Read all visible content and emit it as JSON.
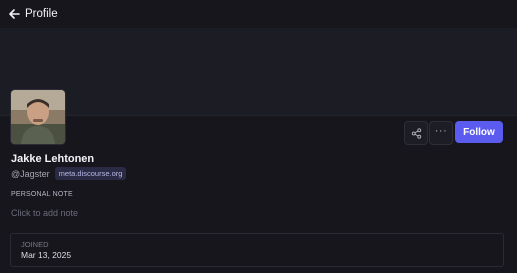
{
  "topbar": {
    "title": "Profile"
  },
  "profile": {
    "name": "Jakke Lehtonen",
    "handle": "@Jagster",
    "domain": "meta.discourse.org",
    "note_label": "PERSONAL NOTE",
    "note_placeholder": "Click to add note",
    "joined_label": "JOINED",
    "joined_date": "Mar 13, 2025"
  },
  "actions": {
    "share_icon": "share-icon",
    "more_icon": "more-icon",
    "more_glyph": "···",
    "follow_label": "Follow"
  },
  "colors": {
    "background": "#16161c",
    "banner": "#1c1c24",
    "accent": "#5b5bf0",
    "badge_bg": "#2a2a44"
  }
}
